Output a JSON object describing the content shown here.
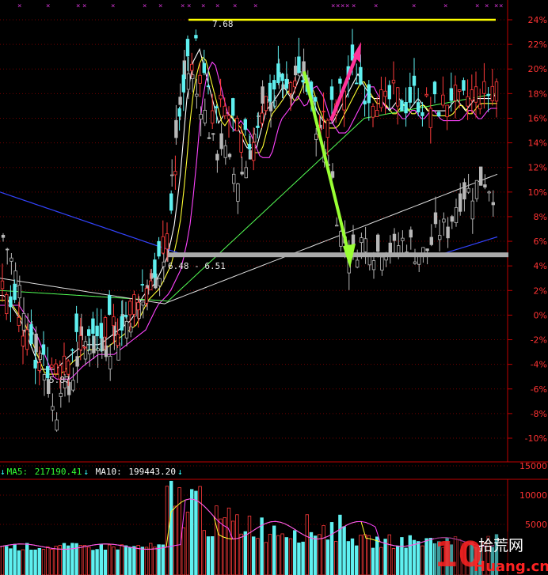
{
  "chart_data": {
    "type": "candlestick",
    "y_axis_ticks": [
      "24%",
      "22%",
      "20%",
      "18%",
      "16%",
      "14%",
      "12%",
      "10%",
      "8%",
      "6%",
      "4%",
      "2%",
      "0%",
      "-2%",
      "-4%",
      "-6%",
      "-8%",
      "-10%"
    ],
    "y_values": [
      24,
      22,
      20,
      18,
      16,
      14,
      12,
      10,
      8,
      6,
      4,
      2,
      0,
      -2,
      -4,
      -6,
      -8,
      -10
    ],
    "ylim": [
      -11.5,
      25.5
    ],
    "annotations": {
      "high": "7.68",
      "low": "5.87",
      "range": "6.48 - 6.51"
    },
    "reference_lines": {
      "high_level": 24,
      "support_level": 4.9
    },
    "volume": {
      "ticks": [
        "15000",
        "10000",
        "5000"
      ],
      "tick_values": [
        15000,
        10000,
        5000
      ],
      "ma5_label": "MA5:",
      "ma5_value": "217190.41",
      "ma10_label": "MA10:",
      "ma10_value": "199443.20"
    },
    "colors": {
      "up": "#ff3b3b",
      "down_bright": "#5ff0f0",
      "down_dim": "#b8b8b8",
      "ma_white": "#ffffff",
      "ma_yellow": "#ffff33",
      "ma_magenta": "#ff44ff",
      "ma_green": "#55ff55",
      "ma_long_white": "#dddddd",
      "ma_blue": "#3344ff",
      "arrow_green": "#99ff33",
      "arrow_pink": "#ff3399",
      "level_line": "#ffff00",
      "support_band": "#aaaaaa"
    }
  },
  "watermark": {
    "number": "10",
    "cn": "拾荒网",
    "en": "Huang.cn"
  }
}
